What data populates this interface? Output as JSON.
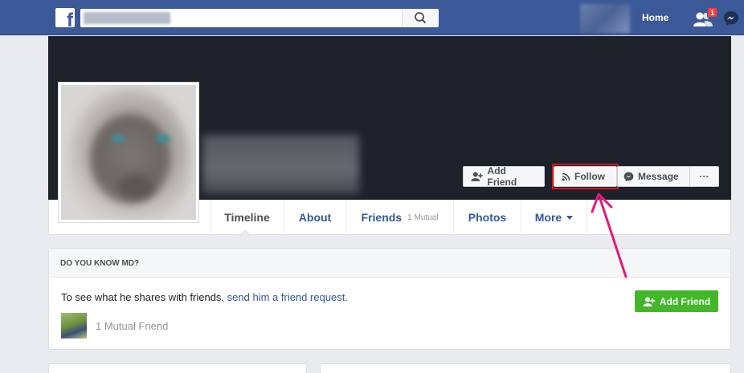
{
  "topbar": {
    "logo_glyph": "f",
    "home_label": "Home",
    "friend_requests_badge": "1",
    "icons": [
      "search-icon",
      "friend-requests-icon",
      "messenger-icon"
    ]
  },
  "profile": {
    "actions": {
      "add_friend": "Add Friend",
      "follow": "Follow",
      "message": "Message",
      "more": "···"
    }
  },
  "tabs": [
    {
      "label": "Timeline",
      "active": true
    },
    {
      "label": "About"
    },
    {
      "label": "Friends",
      "sub": "1 Mutual"
    },
    {
      "label": "Photos"
    },
    {
      "label": "More"
    }
  ],
  "know_card": {
    "title": "DO YOU KNOW MD?",
    "text_prefix": "To see what he shares with friends, ",
    "link_text": "send him a friend request.",
    "mutual": "1 Mutual Friend",
    "button": "Add Friend"
  },
  "colors": {
    "brand": "#3b5998",
    "highlight_box": "#d01a1a",
    "annotation_arrow": "#e8177a",
    "add_friend_green": "#42b72a"
  }
}
